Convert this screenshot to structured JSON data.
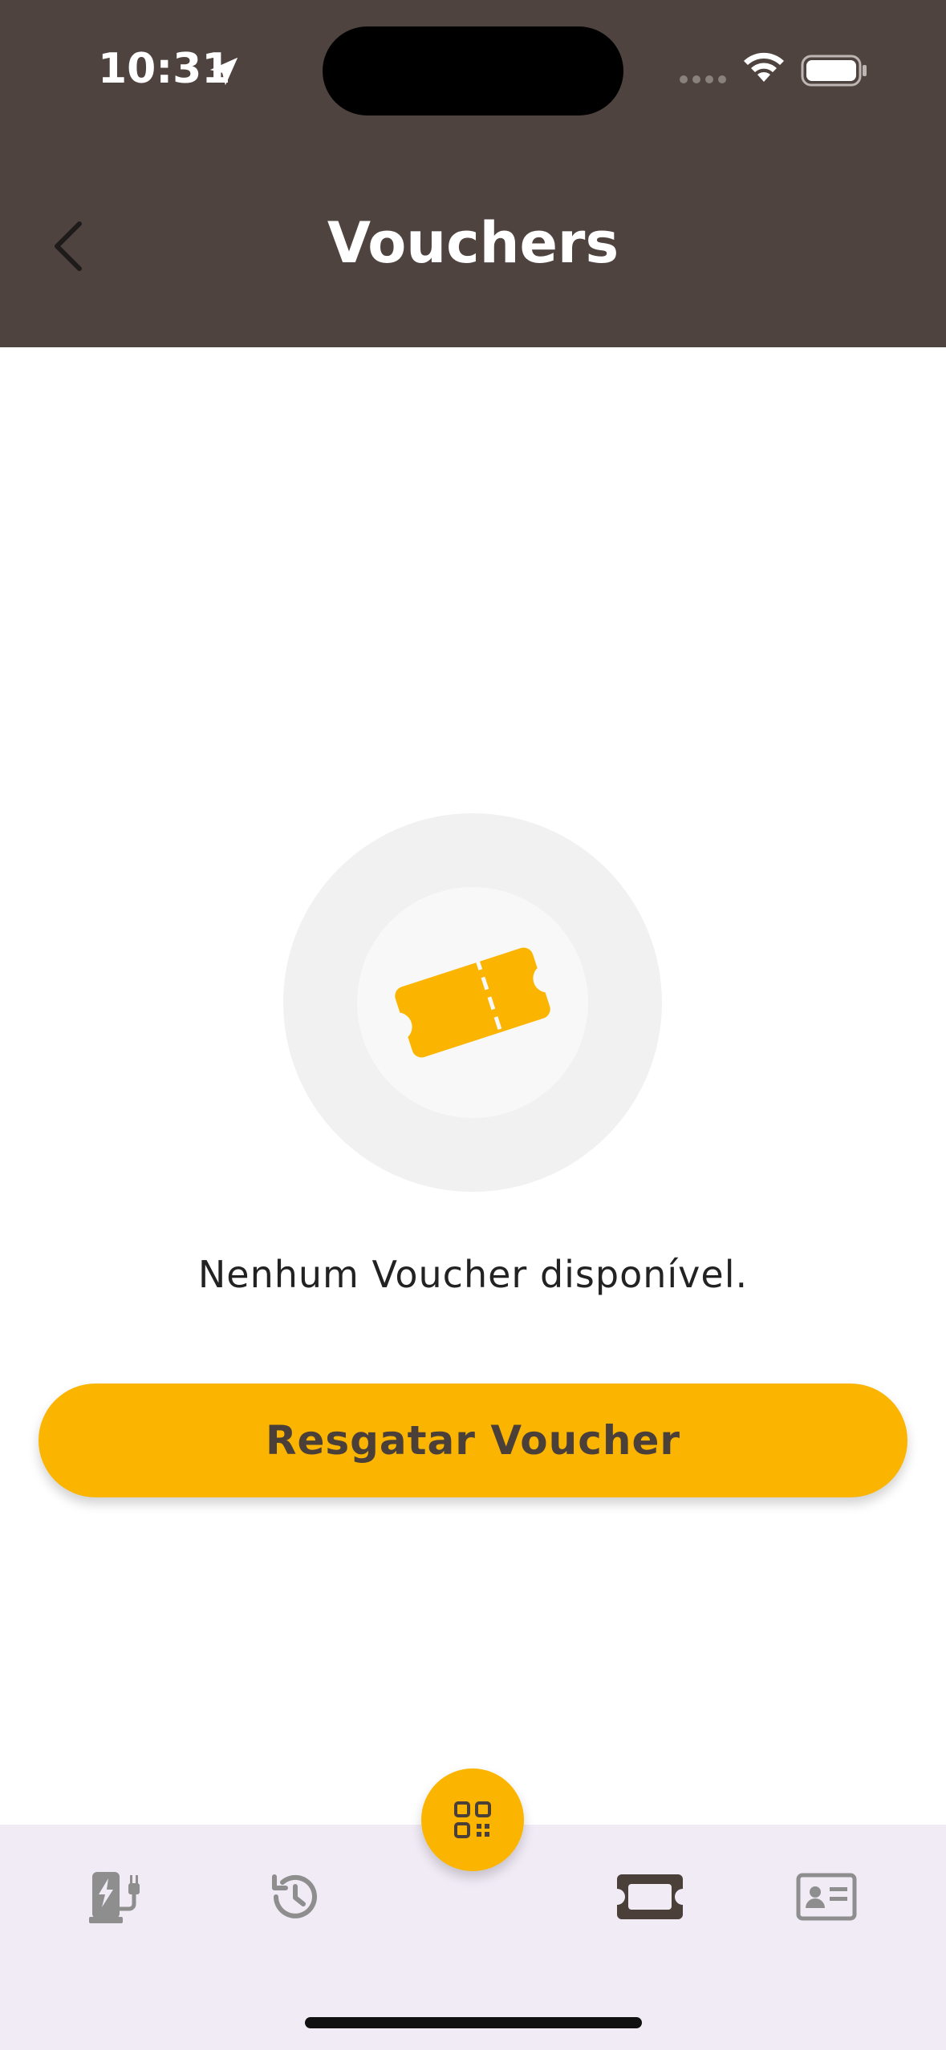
{
  "status_bar": {
    "time": "10:31"
  },
  "header": {
    "title": "Vouchers"
  },
  "empty_state": {
    "message": "Nenhum Voucher disponível.",
    "icon": "ticket-icon"
  },
  "actions": {
    "redeem_label": "Resgatar Voucher"
  },
  "tabbar": {
    "items": [
      {
        "icon": "ev-charger-icon",
        "active": false
      },
      {
        "icon": "history-icon",
        "active": false
      },
      {
        "icon": "qr-code-icon",
        "active": false
      },
      {
        "icon": "voucher-ticket-icon",
        "active": true
      },
      {
        "icon": "id-card-icon",
        "active": false
      }
    ]
  },
  "colors": {
    "header_bg": "#4f433f",
    "accent": "#fbb500",
    "tabbar_bg": "#f1ebf6",
    "inactive_icon": "#8e8e8e",
    "active_icon": "#4a3f39"
  }
}
